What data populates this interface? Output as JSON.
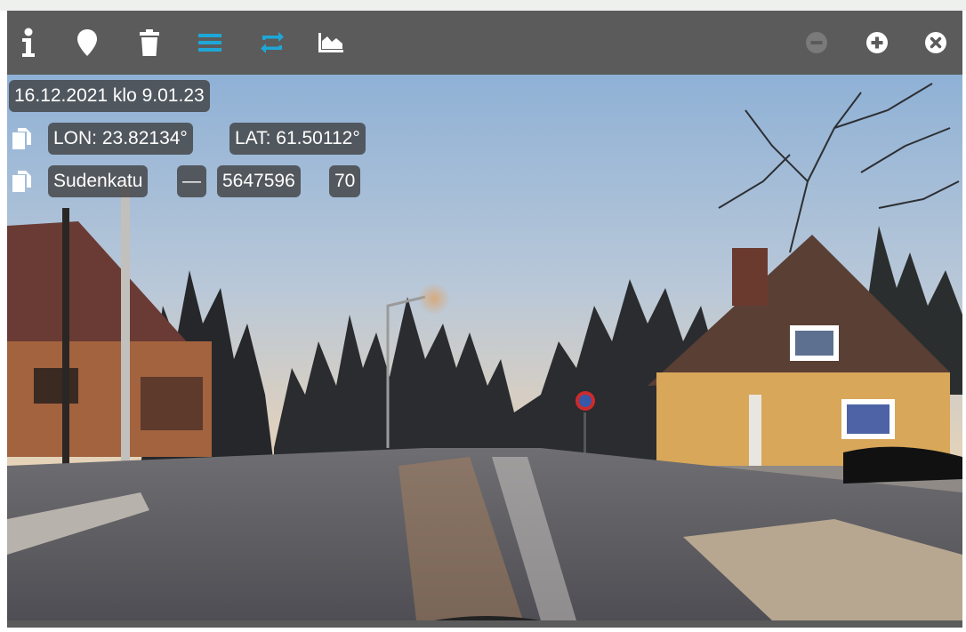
{
  "toolbar": {
    "left_icons": [
      "info-icon",
      "map-marker-icon",
      "trash-icon",
      "list-icon",
      "repeat-icon",
      "area-chart-icon"
    ],
    "right_icons": [
      "zoom-out-icon",
      "zoom-in-icon",
      "close-icon"
    ],
    "colors": {
      "icon_default": "#ffffff",
      "icon_active": "#1ea7d6",
      "icon_disabled": "#7a7a7a",
      "bar": "#5b5b5b"
    }
  },
  "overlay": {
    "timestamp": "16.12.2021 klo 9.01.23",
    "lon_label": "LON: 23.82134°",
    "lat_label": "LAT: 61.50112°",
    "street": "Sudenkatu",
    "separator": "—",
    "id": "5647596",
    "number": "70"
  }
}
